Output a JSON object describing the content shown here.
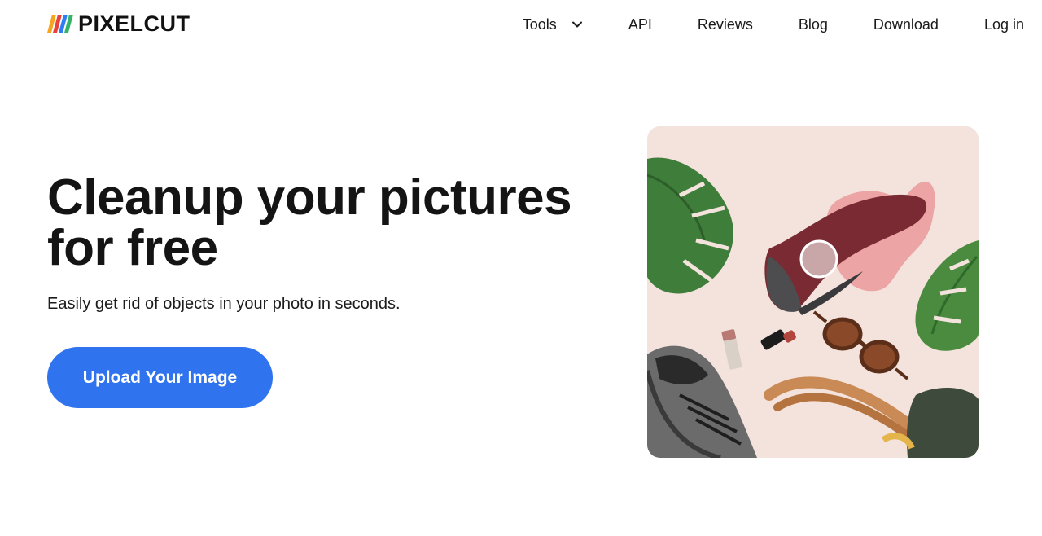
{
  "brand": {
    "name": "PIXELCUT",
    "logo_colors": [
      "#f4a522",
      "#e8413c",
      "#2e7cf6",
      "#35b36b"
    ]
  },
  "nav": {
    "items": [
      {
        "label": "Tools",
        "has_dropdown": true
      },
      {
        "label": "API"
      },
      {
        "label": "Reviews"
      },
      {
        "label": "Blog"
      },
      {
        "label": "Download"
      },
      {
        "label": "Log in"
      }
    ]
  },
  "hero": {
    "title_line1": "Cleanup your pictures",
    "title_line2": "for free",
    "subtitle": "Easily get rid of objects in your photo in seconds.",
    "cta_label": "Upload Your Image",
    "cta_color": "#2f74ee"
  },
  "preview": {
    "background_color": "#f3e3dc",
    "highlight_color": "#ea9a9a",
    "objects": [
      "monstera-leaf",
      "red-sneaker",
      "gray-sneaker",
      "lipstick",
      "lip-balm",
      "sunglasses",
      "leather-tote-bag"
    ]
  }
}
